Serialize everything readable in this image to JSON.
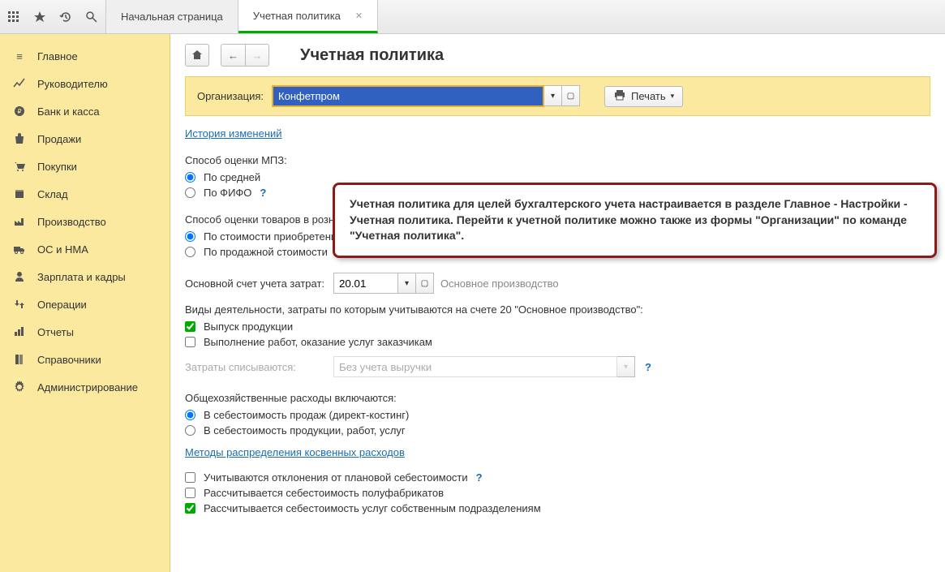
{
  "tabs": {
    "home": "Начальная страница",
    "active": "Учетная политика"
  },
  "sidebar": [
    {
      "icon": "menu",
      "label": "Главное"
    },
    {
      "icon": "chart",
      "label": "Руководителю"
    },
    {
      "icon": "ruble",
      "label": "Банк и касса"
    },
    {
      "icon": "bag",
      "label": "Продажи"
    },
    {
      "icon": "cart",
      "label": "Покупки"
    },
    {
      "icon": "box",
      "label": "Склад"
    },
    {
      "icon": "factory",
      "label": "Производство"
    },
    {
      "icon": "truck",
      "label": "ОС и НМА"
    },
    {
      "icon": "person",
      "label": "Зарплата и кадры"
    },
    {
      "icon": "swap",
      "label": "Операции"
    },
    {
      "icon": "bars",
      "label": "Отчеты"
    },
    {
      "icon": "book",
      "label": "Справочники"
    },
    {
      "icon": "gear",
      "label": "Администрирование"
    }
  ],
  "page": {
    "title": "Учетная политика",
    "org_label": "Организация:",
    "org_value": "Конфетпром",
    "print_label": "Печать",
    "history_link": "История изменений",
    "mpz_label": "Способ оценки МПЗ:",
    "mpz_avg": "По средней",
    "mpz_fifo": "По ФИФО",
    "retail_label": "Способ оценки товаров в рознице:",
    "retail_cost": "По стоимости приобретения",
    "retail_sale": "По продажной стоимости",
    "main_account_label": "Основной счет учета затрат:",
    "main_account_value": "20.01",
    "main_account_hint": "Основное производство",
    "activities_label": "Виды деятельности, затраты по которым учитываются на счете 20 \"Основное производство\":",
    "act_output": "Выпуск продукции",
    "act_services": "Выполнение работ, оказание услуг заказчикам",
    "writeoff_label": "Затраты списываются:",
    "writeoff_value": "Без учета выручки",
    "overhead_label": "Общехозяйственные расходы включаются:",
    "overhead_direct": "В себестоимость продаж (директ-костинг)",
    "overhead_full": "В  себестоимость продукции, работ, услуг",
    "methods_link": "Методы распределения косвенных расходов",
    "chk_plan": "Учитываются отклонения от плановой себестоимости",
    "chk_semi": "Рассчитывается себестоимость полуфабрикатов",
    "chk_own": "Рассчитывается себестоимость услуг собственным подразделениям"
  },
  "callout": {
    "text": "Учетная политика для целей бухгалтерского учета настраивается в разделе Главное - Настройки - Учетная политика. Перейти к учетной политике можно также из формы \"Организации\" по команде \"Учетная политика\"."
  }
}
